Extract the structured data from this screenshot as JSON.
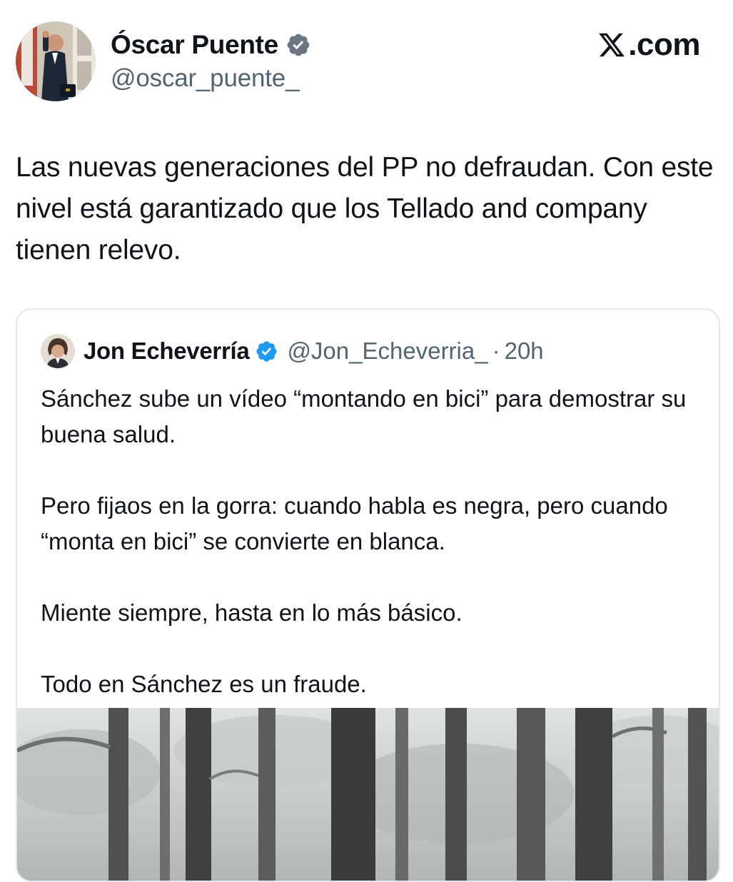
{
  "author": {
    "name": "Óscar Puente",
    "handle": "@oscar_puente_",
    "verified": true
  },
  "site": {
    "label": ".com",
    "logo": "x-logo-icon"
  },
  "tweet": {
    "text": "Las nuevas generaciones del PP no defraudan. Con este nivel está garantizado que los Tellado and company tienen relevo."
  },
  "quote": {
    "name": "Jon Echeverría",
    "handle": "@Jon_Echeverria_",
    "separator": "·",
    "time": "20h",
    "verified": true,
    "paragraphs": [
      "Sánchez sube un vídeo “montando en bici” para demostrar su buena salud.",
      "Pero fijaos en la gorra: cuando habla es negra, pero cuando “monta en bici” se convierte en blanca.",
      "Miente siempre, hasta en lo más básico.",
      "Todo en Sánchez es un fraude."
    ]
  },
  "colors": {
    "text": "#0f1419",
    "secondary": "#536471",
    "verified": "#1d9bf0",
    "border": "#e1e8ed"
  }
}
